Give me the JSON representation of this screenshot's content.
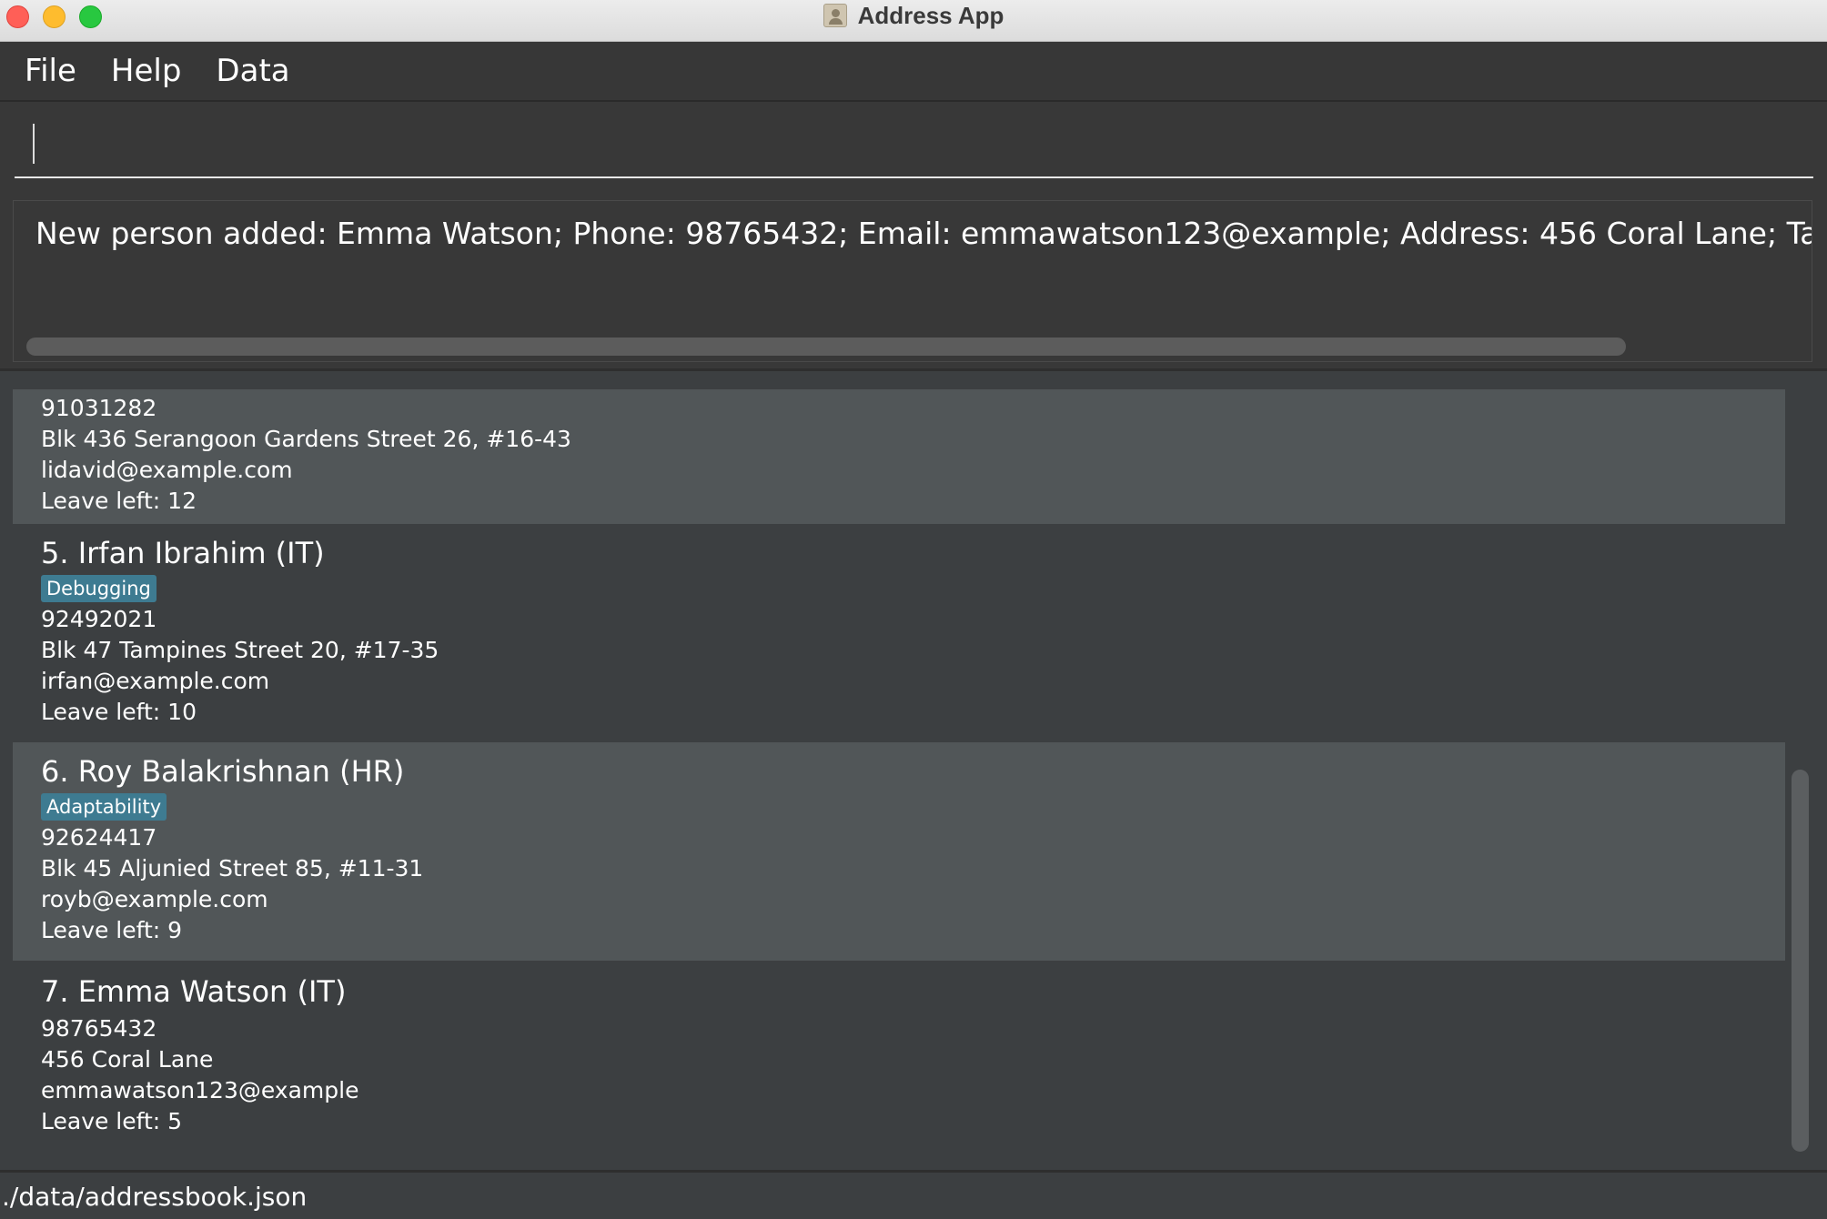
{
  "window": {
    "title": "Address App"
  },
  "menu": {
    "file": "File",
    "help": "Help",
    "data": "Data"
  },
  "command": {
    "value": ""
  },
  "result": {
    "text": "New person added: Emma Watson; Phone: 98765432; Email: emmawatson123@example; Address: 456 Coral Lane; Tags: ; Departmer"
  },
  "persons": [
    {
      "phone": "91031282",
      "address": "Blk 436 Serangoon Gardens Street 26, #16-43",
      "email": "lidavid@example.com",
      "leave": "Leave left: 12"
    },
    {
      "name": "5. Irfan Ibrahim  (IT)",
      "tag": "Debugging",
      "phone": "92492021",
      "address": "Blk 47 Tampines Street 20, #17-35",
      "email": "irfan@example.com",
      "leave": "Leave left: 10"
    },
    {
      "name": "6. Roy Balakrishnan  (HR)",
      "tag": "Adaptability",
      "phone": "92624417",
      "address": "Blk 45 Aljunied Street 85, #11-31",
      "email": "royb@example.com",
      "leave": "Leave left: 9"
    },
    {
      "name": "7. Emma Watson  (IT)",
      "phone": "98765432",
      "address": "456 Coral Lane",
      "email": "emmawatson123@example",
      "leave": "Leave left: 5"
    }
  ],
  "status": {
    "path": "./data/addressbook.json"
  }
}
